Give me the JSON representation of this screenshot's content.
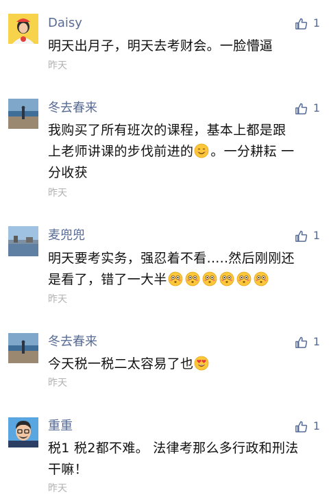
{
  "comments": [
    {
      "name": "Daisy",
      "likes": "1",
      "time": "昨天",
      "text_lines": [
        "明天出月子，明天去考财会。一脸懵逼"
      ]
    },
    {
      "name": "冬去春来",
      "likes": "1",
      "time": "昨天",
      "text_lines": [
        "我购买了所有班次的课程，基本上都是跟",
        "上老师讲课的步伐前进的",
        "。一分耕耘 一",
        "分收获"
      ]
    },
    {
      "name": "麦兜兜",
      "likes": "1",
      "time": "昨天",
      "text_lines": [
        "明天要考实务，强忍着不看.....然后刚刚还",
        "是看了，错了一大半"
      ]
    },
    {
      "name": "冬去春来",
      "likes": "1",
      "time": "昨天",
      "text_lines": [
        "今天税一税二太容易了也"
      ]
    },
    {
      "name": "重重",
      "likes": "1",
      "time": "昨天",
      "text_lines": [
        "税1 税2都不难。 法律考那么多行政和刑法",
        "干嘛！"
      ]
    }
  ],
  "icons": {
    "like": "thumbs-up-icon",
    "smile_emoji": "smiling-face-emoji",
    "flushed_emoji": "flushed-face-emoji",
    "heart_eyes_emoji": "heart-eyes-emoji"
  },
  "colors": {
    "name": "#576b95",
    "text": "#111111",
    "time": "#b2b2b2",
    "like_icon": "#576b95"
  }
}
